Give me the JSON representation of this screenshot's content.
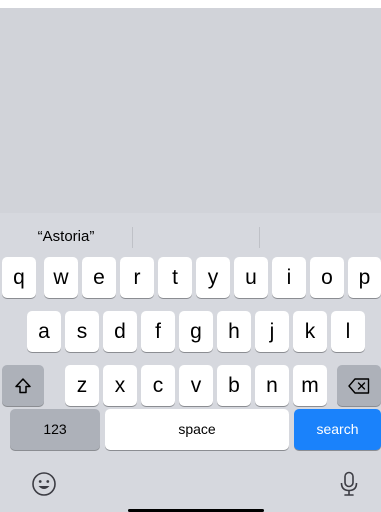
{
  "suggestions": [
    "“Astoria”",
    "",
    ""
  ],
  "keyboard": {
    "row1": [
      "q",
      "w",
      "e",
      "r",
      "t",
      "y",
      "u",
      "i",
      "o",
      "p"
    ],
    "row2": [
      "a",
      "s",
      "d",
      "f",
      "g",
      "h",
      "j",
      "k",
      "l"
    ],
    "row3": [
      "z",
      "x",
      "c",
      "v",
      "b",
      "n",
      "m"
    ],
    "numbers_label": "123",
    "space_label": "space",
    "action_label": "search"
  },
  "icons": {
    "shift": "shift-icon",
    "delete": "backspace-icon",
    "emoji": "emoji-icon",
    "dictation": "microphone-icon"
  },
  "colors": {
    "keyboard_bg": "#d6d8de",
    "content_bg": "#d1d3d9",
    "action_key": "#1a82fb",
    "modifier_key": "#adb1b9"
  }
}
